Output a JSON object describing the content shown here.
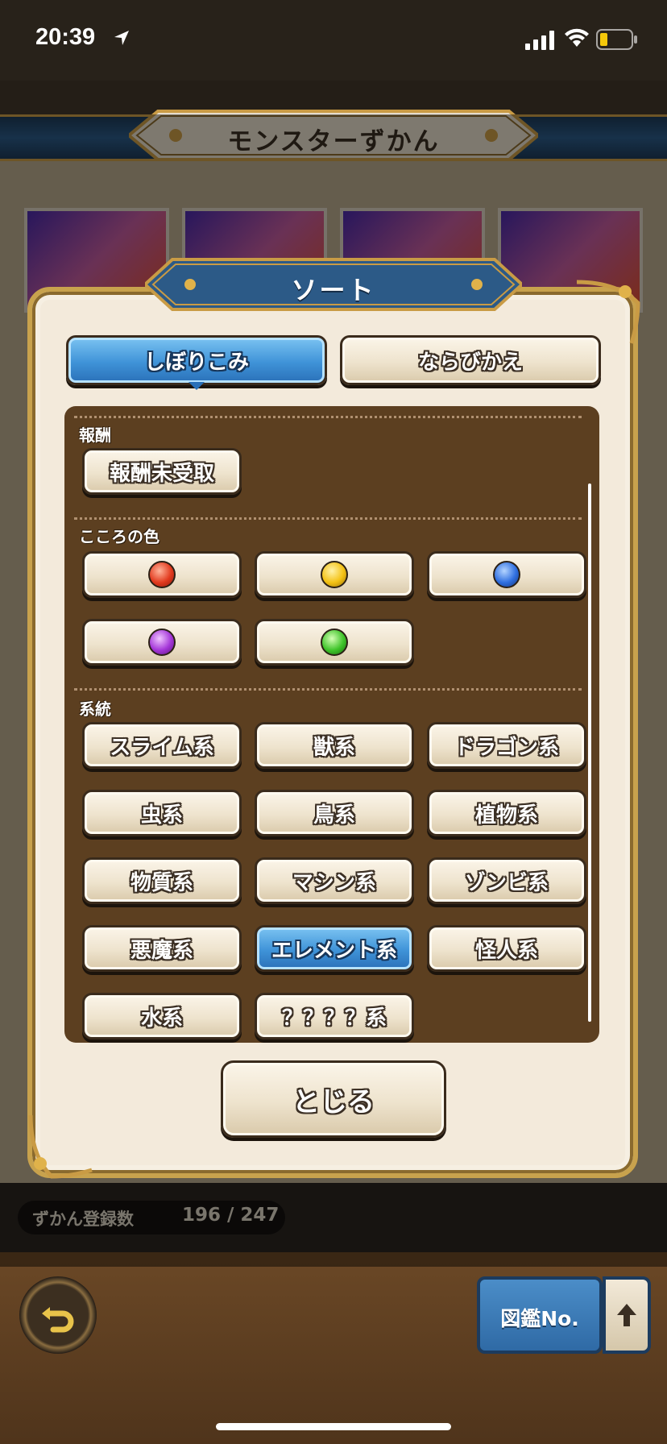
{
  "status_bar": {
    "time": "20:39"
  },
  "screen": {
    "title": "モンスターずかん"
  },
  "collection": {
    "label": "ずかん登録数",
    "value": "196 / 247"
  },
  "controls": {
    "sort_key_label": "図鑑No.",
    "order_icon": "arrow-up-icon",
    "back_icon": "return-arrow-icon"
  },
  "modal": {
    "title": "ソート",
    "tabs": [
      {
        "label": "しぼりこみ",
        "active": true
      },
      {
        "label": "ならびかえ",
        "active": false
      }
    ],
    "sections": {
      "reward": {
        "label": "報酬",
        "options": [
          "報酬未受取"
        ]
      },
      "heart_color": {
        "label": "こころの色",
        "options": [
          {
            "name": "red",
            "color": "#e23a1e"
          },
          {
            "name": "yellow",
            "color": "#f4c214"
          },
          {
            "name": "blue",
            "color": "#2f6fe0"
          },
          {
            "name": "purple",
            "color": "#a436d8"
          },
          {
            "name": "green",
            "color": "#3fc42a"
          }
        ]
      },
      "family": {
        "label": "系統",
        "options": [
          "スライム系",
          "獣系",
          "ドラゴン系",
          "虫系",
          "鳥系",
          "植物系",
          "物質系",
          "マシン系",
          "ゾンビ系",
          "悪魔系",
          "エレメント系",
          "怪人系",
          "水系",
          "？？？？系"
        ],
        "selected": "エレメント系"
      }
    },
    "close_label": "とじる"
  }
}
